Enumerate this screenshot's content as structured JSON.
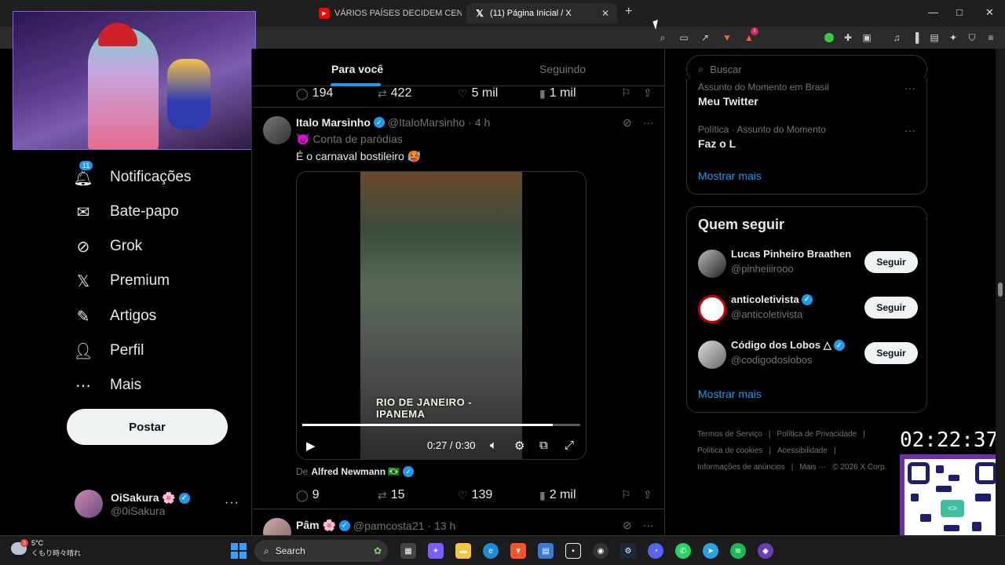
{
  "browser": {
    "tabs": [
      {
        "label": "VÁRIOS PAÍSES DECIDEM CENSURAR",
        "icon": "youtube-icon"
      },
      {
        "label": "(11) Página Inicial / X",
        "icon": "x-logo-icon"
      }
    ],
    "new_tab": "+",
    "window_controls": [
      "—",
      "□",
      "✕"
    ],
    "extension_badge": "1"
  },
  "leftnav": {
    "items": [
      {
        "label": "Notificações",
        "icon": "bell-icon",
        "badge": "11"
      },
      {
        "label": "Bate-papo",
        "icon": "envelope-icon"
      },
      {
        "label": "Grok",
        "icon": "grok-icon"
      },
      {
        "label": "Premium",
        "icon": "x-logo-icon"
      },
      {
        "label": "Artigos",
        "icon": "article-icon"
      },
      {
        "label": "Perfil",
        "icon": "person-icon"
      },
      {
        "label": "Mais",
        "icon": "more-circle-icon"
      }
    ],
    "post_label": "Postar",
    "profile": {
      "name": "OiSakura 🌸",
      "handle": "@0iSakura"
    }
  },
  "feed": {
    "tabs": [
      "Para você",
      "Seguindo"
    ],
    "prev_tweet_actions": {
      "replies": "194",
      "reposts": "422",
      "likes": "5 mil",
      "views": "1 mil"
    },
    "tweet": {
      "name": "Italo Marsinho",
      "handle": "@ItaloMarsinho",
      "time": "4 h",
      "subtitle": "😈 Conta de paródias",
      "text": "É o carnaval bostileiro 🥵",
      "video_caption": "RIO DE JANEIRO - IPANEMA",
      "video_time": "0:27 / 0:30",
      "video_progress": 0.9,
      "from_label": "De",
      "from_name": "Alfred Newmann 🇧🇷",
      "actions": {
        "replies": "9",
        "reposts": "15",
        "likes": "139",
        "views": "2 mil"
      }
    },
    "next_tweet": {
      "name": "Pâm 🌸",
      "handle": "@pamcosta21",
      "time": "13 h"
    }
  },
  "right": {
    "search_placeholder": "Buscar",
    "trends": [
      {
        "category": "Assunto do Momento em Brasil",
        "name": "Meu Twitter"
      },
      {
        "category": "Política · Assunto do Momento",
        "name": "Faz o L"
      }
    ],
    "show_more": "Mostrar mais",
    "who_to_follow_title": "Quem seguir",
    "follow": [
      {
        "name": "Lucas Pinheiro Braathen",
        "handle": "@pinheiiirooo",
        "verified": false
      },
      {
        "name": "anticoletivista",
        "handle": "@anticoletivista",
        "verified": true
      },
      {
        "name": "Código dos Lobos △",
        "handle": "@codigodoslobos",
        "verified": true
      }
    ],
    "follow_label": "Seguir",
    "footer": [
      "Termos de Serviço",
      "|",
      "Política de Privacidade",
      "|",
      "Política de cookies",
      "|",
      "Acessibilidade",
      "|",
      "Informações de anúncios",
      "|",
      "Mais ···",
      "© 2026 X Corp."
    ]
  },
  "overlay": {
    "clock": "02:22:37"
  },
  "taskbar": {
    "weather_temp": "5°C",
    "weather_desc": "くもり時々晴れ",
    "weather_badge": "3",
    "search_label": "Search"
  }
}
